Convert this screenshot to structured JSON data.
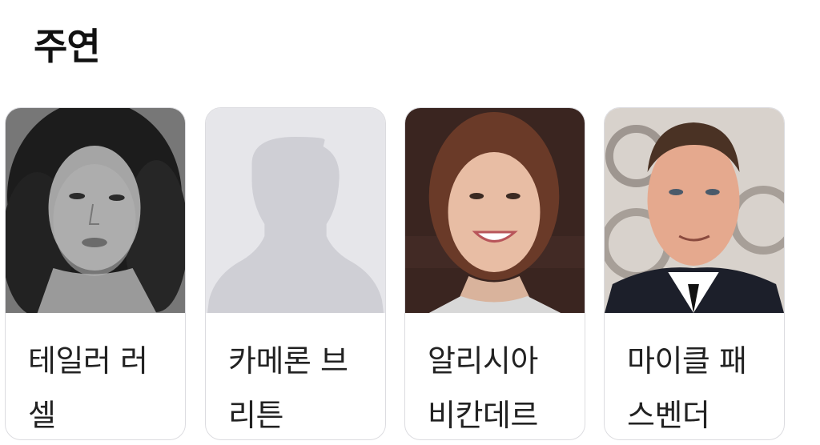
{
  "section": {
    "title": "주연"
  },
  "cast": [
    {
      "name": "테일러 러셀",
      "photo": "bw-portrait-curly-hair"
    },
    {
      "name": "카메론 브리튼",
      "photo": "default-profile-placeholder"
    },
    {
      "name": "알리시아 비칸데르",
      "photo": "smiling-woman-portrait"
    },
    {
      "name": "마이클 패스벤더",
      "photo": "man-in-suit-portrait"
    }
  ],
  "colors": {
    "placeholder_bg": "#e6e6ea",
    "placeholder_silhouette": "#cfcfd5",
    "card_border": "#dcdce0"
  }
}
